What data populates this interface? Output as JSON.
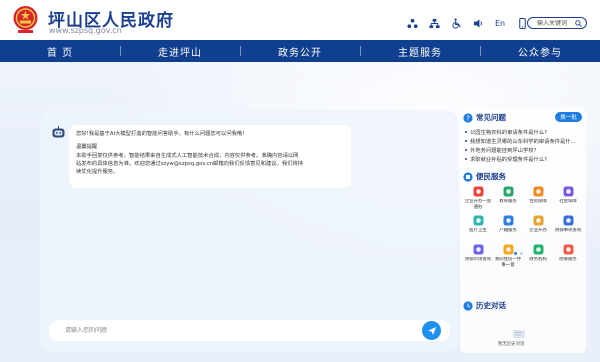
{
  "header": {
    "title": "坪山区人民政府",
    "url": "www.szpsq.gov.cn",
    "tools": [
      {
        "name": "accessibility-network-icon"
      },
      {
        "name": "sitemap-icon"
      },
      {
        "name": "wheelchair-icon"
      },
      {
        "name": "speaker-icon"
      },
      {
        "name": "english-link",
        "label": "En"
      },
      {
        "name": "mobile-icon"
      }
    ],
    "search_placeholder": "输入关键词"
  },
  "nav": {
    "items": [
      "首 页",
      "走进坪山",
      "政务公开",
      "主题服务",
      "公众参与"
    ]
  },
  "chat": {
    "greeting": "您好!我是基于AI大模型打造的智能问答助手，有什么问题您可以问我哦!",
    "notice_title": "温馨提醒",
    "notice_lines": [
      "本助手回复仅供参考，智能结果来自生成式人工智能技术合成，内容仅供参考。准确内容请以网",
      "站发布的具体信息为准。欢迎您通过szyw@szpsq.gov.cn邮箱向我们反馈意见和建议，我们将持",
      "续优化提升服务。"
    ],
    "input_placeholder": "请输入您的问题"
  },
  "side": {
    "faq_title": "常见问题",
    "swap_label": "换一批",
    "faqs": [
      "公园生物农科的审请条件是什么?",
      "我想知道生灵哪的山东科学的审请条件是什...",
      "外地务问题能挂到坪山学校？",
      "求职就业补贴的受理条件是什么?"
    ],
    "services_title": "便民服务",
    "services": [
      {
        "label": "企业开办一窗通办",
        "icon": "enterprise-icon",
        "color": "#e8443a"
      },
      {
        "label": "教育服务",
        "icon": "education-icon",
        "color": "#2aa46b"
      },
      {
        "label": "住房保障",
        "icon": "house-icon",
        "color": "#f08a1f"
      },
      {
        "label": "社会保障",
        "icon": "shield-icon",
        "color": "#7b5ad9"
      },
      {
        "label": "医疗卫生",
        "icon": "medical-icon",
        "color": "#2fb5b0"
      },
      {
        "label": "户籍服务",
        "icon": "household-icon",
        "color": "#2f7fe0"
      },
      {
        "label": "企业开办",
        "icon": "building-icon",
        "color": "#e8a12c"
      },
      {
        "label": "防御事项查询",
        "icon": "query-icon",
        "color": "#3a6fd8"
      },
      {
        "label": "防御市场查询",
        "icon": "search-doc-icon",
        "color": "#6c63e6"
      },
      {
        "label": "我的住房一件事一窗",
        "icon": "key-icon",
        "color": "#f5a623"
      },
      {
        "label": "政务机构",
        "icon": "org-icon",
        "color": "#1fb36c"
      },
      {
        "label": "防御服务",
        "icon": "service-icon",
        "color": "#ee5b4a"
      }
    ],
    "history_title": "历史对话",
    "history_empty": "暂无历史对话"
  }
}
